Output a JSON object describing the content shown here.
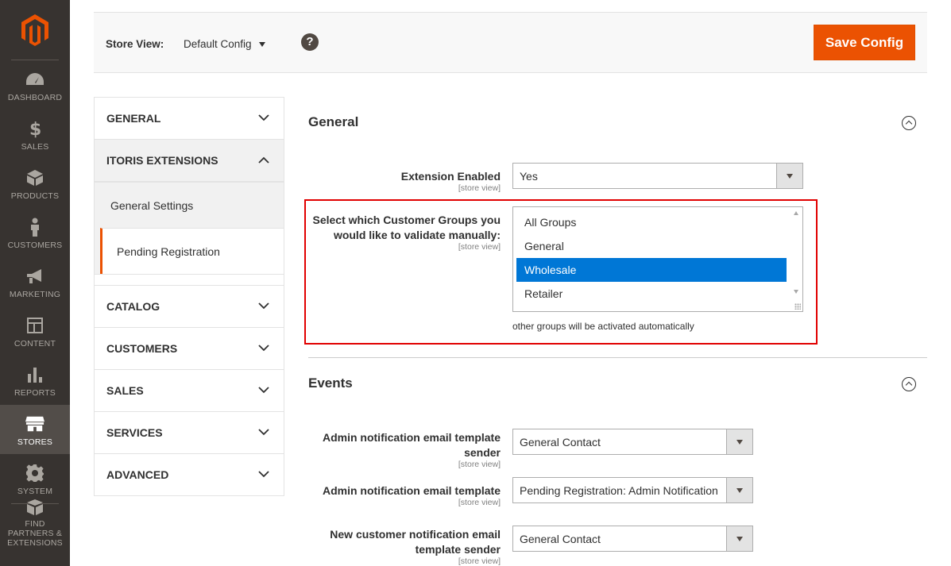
{
  "admin_menu": {
    "items": [
      {
        "label": "DASHBOARD",
        "icon": "dashboard-icon"
      },
      {
        "label": "SALES",
        "icon": "dollar-icon"
      },
      {
        "label": "PRODUCTS",
        "icon": "box-icon"
      },
      {
        "label": "CUSTOMERS",
        "icon": "person-icon"
      },
      {
        "label": "MARKETING",
        "icon": "megaphone-icon"
      },
      {
        "label": "CONTENT",
        "icon": "layout-icon"
      },
      {
        "label": "REPORTS",
        "icon": "bar-chart-icon"
      },
      {
        "label": "STORES",
        "icon": "storefront-icon"
      },
      {
        "label": "SYSTEM",
        "icon": "gear-icon"
      },
      {
        "label": "FIND PARTNERS & EXTENSIONS",
        "icon": "boxes-icon"
      }
    ],
    "active_item": "STORES",
    "logo_color": "#eb5202"
  },
  "toolbar": {
    "store_view_label": "Store View:",
    "store_view_value": "Default Config",
    "help_label": "?",
    "save_label": "Save Config",
    "save_color": "#eb5202"
  },
  "tabs": {
    "groups": [
      {
        "label": "GENERAL",
        "open": false
      },
      {
        "label": "ITORIS EXTENSIONS",
        "open": true,
        "items": [
          "General Settings",
          "Pending Registration"
        ],
        "active_item": "Pending Registration"
      },
      {
        "label": "CATALOG",
        "open": false
      },
      {
        "label": "CUSTOMERS",
        "open": false
      },
      {
        "label": "SALES",
        "open": false
      },
      {
        "label": "SERVICES",
        "open": false
      },
      {
        "label": "ADVANCED",
        "open": false
      }
    ]
  },
  "general_section": {
    "title": "General",
    "extension_enabled": {
      "label": "Extension Enabled",
      "scope": "[store view]",
      "value": "Yes"
    },
    "customer_groups": {
      "label": "Select which Customer Groups you would like to validate manually:",
      "scope": "[store view]",
      "options": [
        "All Groups",
        "General",
        "Wholesale",
        "Retailer"
      ],
      "selected": "Wholesale",
      "note": "other groups will be activated automatically"
    }
  },
  "events_section": {
    "title": "Events",
    "admin_sender": {
      "label": "Admin notification email template sender",
      "scope": "[store view]",
      "value": "General Contact"
    },
    "admin_template": {
      "label": "Admin notification email template",
      "scope": "[store view]",
      "value": "Pending Registration: Admin Notification"
    },
    "customer_sender": {
      "label": "New customer notification email template sender",
      "scope": "[store view]",
      "value": "General Contact"
    }
  },
  "colors": {
    "highlight_frame": "#e10000",
    "selected_option": "#0077d6",
    "active_tab_border": "#eb5202"
  }
}
